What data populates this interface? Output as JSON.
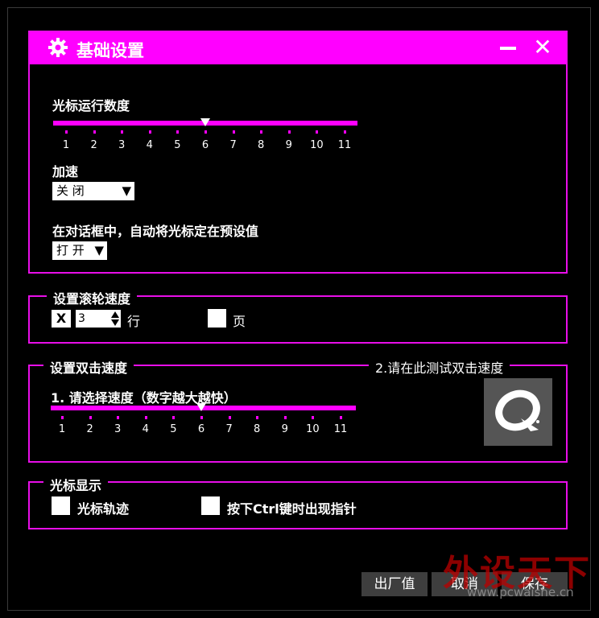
{
  "window": {
    "title": "基础设置",
    "minimize_icon": "minimize-icon",
    "close_label": "✕"
  },
  "pointer_speed": {
    "label": "光标运行数度",
    "ticks": [
      "1",
      "2",
      "3",
      "4",
      "5",
      "6",
      "7",
      "8",
      "9",
      "10",
      "11"
    ],
    "value": 6
  },
  "acceleration": {
    "label": "加速",
    "selected": "关 闭"
  },
  "snap_to": {
    "label": "在对话框中，自动将光标定在预设值",
    "selected": "打 开"
  },
  "scroll": {
    "title": "设置滚轮速度",
    "x_label": "X",
    "lines_value": "3",
    "lines_unit": "行",
    "page_unit": "页"
  },
  "double_click": {
    "title": "设置双击速度",
    "test_title": "2.请在此测试双击速度",
    "step_label": "1. 请选择速度（数字越大越快）",
    "ticks": [
      "1",
      "2",
      "3",
      "4",
      "5",
      "6",
      "7",
      "8",
      "9",
      "10",
      "11"
    ],
    "value": 6
  },
  "pointer_display": {
    "title": "光标显示",
    "trail_label": "光标轨迹",
    "ctrl_label": "按下Ctrl键时出现指针"
  },
  "buttons": {
    "factory": "出厂值",
    "cancel": "取消",
    "save": "保存"
  },
  "watermark": {
    "text": "外设天下",
    "url": "www.pcwaishe.cn"
  },
  "colors": {
    "accent": "#ff00ff",
    "background": "#000000"
  }
}
